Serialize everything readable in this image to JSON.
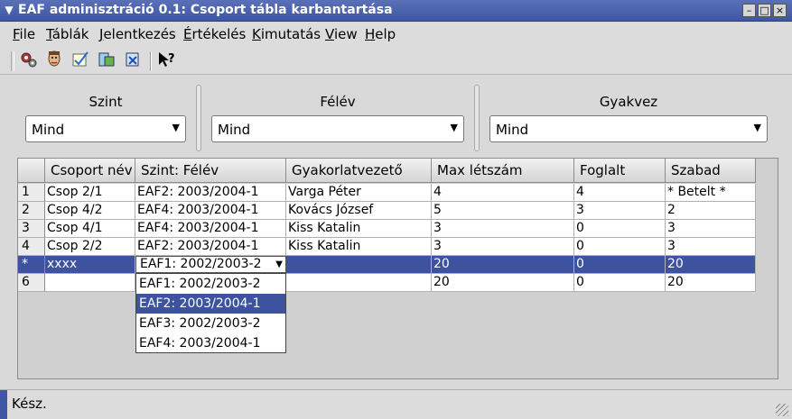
{
  "window": {
    "title": "EAF adminisztráció 0.1: Csoport tábla karbantartása",
    "menu_icon": "chevron-down-icon",
    "minimize_icon": "minimize-icon",
    "maximize_icon": "maximize-icon",
    "close_icon": "close-icon"
  },
  "menu": [
    {
      "label": "File"
    },
    {
      "label": "Táblák"
    },
    {
      "label": "Jelentkezés"
    },
    {
      "label": "Értékelés"
    },
    {
      "label": "Kimutatás"
    },
    {
      "label": "View"
    },
    {
      "label": "Help"
    }
  ],
  "toolbar": [
    "gears-icon",
    "person-icon",
    "checklist-icon",
    "database-icon",
    "export-icon",
    "whats-this-help-icon"
  ],
  "filters": {
    "szint": {
      "label": "Szint",
      "value": "Mind"
    },
    "felev": {
      "label": "Félév",
      "value": "Mind"
    },
    "gyakvez": {
      "label": "Gyakvez",
      "value": "Mind"
    }
  },
  "table": {
    "columns": [
      "Csoport név",
      "Szint: Félév",
      "Gyakorlatvezető",
      "Max létszám",
      "Foglalt",
      "Szabad"
    ],
    "rows": [
      {
        "num": "1",
        "cells": [
          "Csop 2/1",
          "EAF2: 2003/2004-1",
          "Varga Péter",
          "4",
          "4",
          "* Betelt *"
        ]
      },
      {
        "num": "2",
        "cells": [
          "Csop 4/2",
          "EAF4: 2003/2004-1",
          "Kovács  József",
          "5",
          "3",
          "2"
        ]
      },
      {
        "num": "3",
        "cells": [
          "Csop 4/1",
          "EAF4: 2003/2004-1",
          "Kiss Katalin",
          "3",
          "0",
          "3"
        ]
      },
      {
        "num": "4",
        "cells": [
          "Csop 2/2",
          "EAF2: 2003/2004-1",
          "Kiss Katalin",
          "3",
          "0",
          "3"
        ]
      },
      {
        "num": "*",
        "cells": [
          "xxxx",
          "EAF1: 2002/2003-2",
          "",
          "20",
          "0",
          "20"
        ]
      },
      {
        "num": "6",
        "cells": [
          "",
          "",
          "",
          "20",
          "0",
          "20"
        ]
      }
    ],
    "editor_options": [
      "EAF1: 2002/2003-2",
      "EAF2: 2003/2004-1",
      "EAF3: 2002/2003-2",
      "EAF4: 2003/2004-1"
    ],
    "editor_selected_option": "EAF2: 2003/2004-1"
  },
  "status": {
    "text": "Kész."
  },
  "colors": {
    "accent": "#3d53a0",
    "titlebar": "#4a62ae",
    "window_bg": "#d9d9d9"
  }
}
